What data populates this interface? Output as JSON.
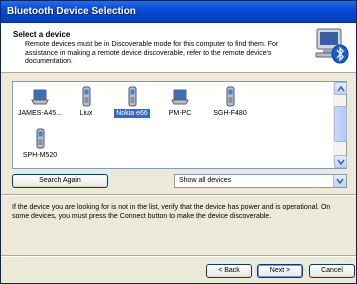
{
  "window": {
    "title": "Bluetooth Device Selection"
  },
  "header": {
    "title": "Select a device",
    "description": "Remote devices must be in Discoverable mode for this computer to find them. For assistance in making a remote device discoverable, refer to the remote device's documentation.",
    "icon": "bluetooth-computer-icon"
  },
  "devices": [
    {
      "label": "JAMES-A45...",
      "icon": "laptop-icon",
      "selected": false
    },
    {
      "label": "Liux",
      "icon": "mobile-phone-icon",
      "selected": false
    },
    {
      "label": "Nokia e66",
      "icon": "mobile-phone-icon",
      "selected": true
    },
    {
      "label": "PM-PC",
      "icon": "laptop-icon",
      "selected": false
    },
    {
      "label": "SGH-F480",
      "icon": "mobile-phone-icon",
      "selected": false
    },
    {
      "label": "SPH-M520",
      "icon": "mobile-phone-icon",
      "selected": false
    }
  ],
  "controls": {
    "search_again": "Search Again",
    "filter_selected": "Show all devices"
  },
  "info": {
    "text": "If the device you are looking for is not in the list, verify that the device has power and is operational. On some devices, you must press the Connect button to make the device discoverable."
  },
  "footer": {
    "back": "< Back",
    "next": "Next >",
    "cancel": "Cancel"
  },
  "colors": {
    "titlebar": "#0a4fd6",
    "selection": "#316ac5",
    "dialog_bg": "#ece9d8"
  }
}
